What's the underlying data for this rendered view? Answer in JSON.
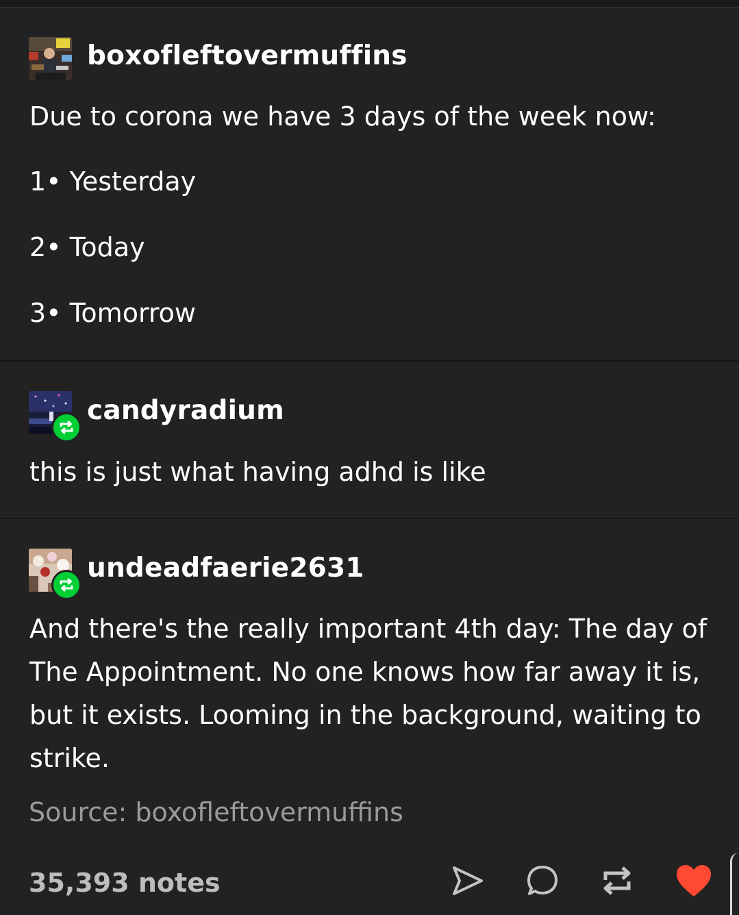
{
  "posts": [
    {
      "username": "boxofleftovermuffins",
      "lines": [
        "Due to corona we have 3 days of the week now:",
        "1• Yesterday",
        "2• Today",
        "3• Tomorrow"
      ]
    },
    {
      "username": "candyradium",
      "reblogged": true,
      "text": "this is just what having adhd is like"
    },
    {
      "username": "undeadfaerie2631",
      "reblogged": true,
      "lines": [
        "And there's the really important 4th day: The day of",
        "The Appointment. No one knows how far away it is,",
        "but it exists. Looming in the background, waiting to",
        "strike."
      ]
    }
  ],
  "source": "Source: boxofleftovermuffins",
  "footer": {
    "notes": "35,393 notes",
    "actions": [
      "send-icon",
      "comment-icon",
      "reblog-icon",
      "like-heart-icon"
    ]
  },
  "colors": {
    "background": "#222222",
    "reblog_badge": "#00cf35",
    "like": "#ff4930",
    "muted_text": "#9a9a9a"
  }
}
